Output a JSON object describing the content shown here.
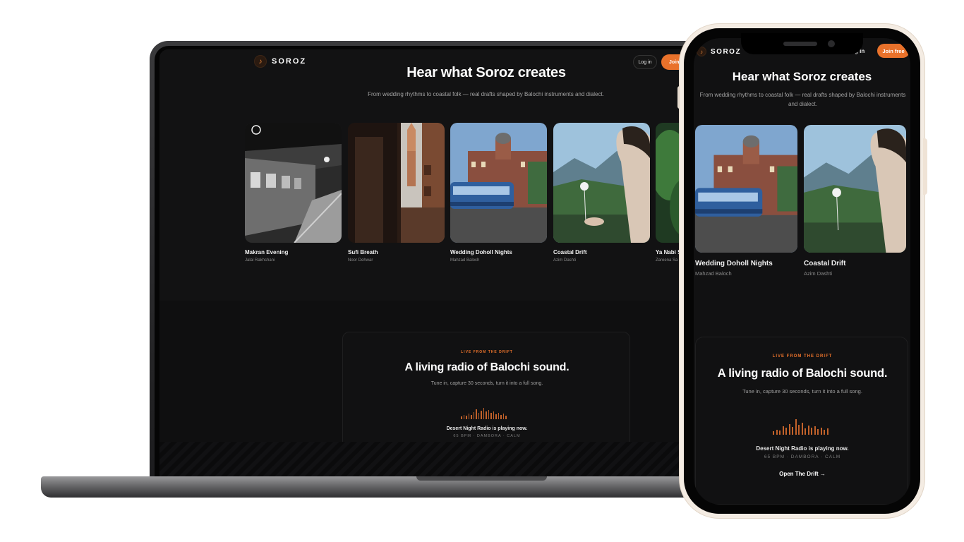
{
  "brand": {
    "name": "SOROZ",
    "accent": "#e9722b"
  },
  "nav": {
    "login": "Log in",
    "join": "Join free",
    "join_truncated": "Join",
    "login_cut": "g in"
  },
  "hero": {
    "title": "Hear what Soroz creates",
    "subtitle": "From wedding rhythms to coastal folk — real drafts shaped by Balochi instruments and dialect."
  },
  "tracks": [
    {
      "title": "Makran Evening",
      "artist": "Jalal Rakhshani",
      "scene": "subway-train"
    },
    {
      "title": "Sufi Breath",
      "artist": "Noor Dehwar",
      "scene": "narrow-street-tower"
    },
    {
      "title": "Wedding Doholl Nights",
      "artist": "Mahzad Baloch",
      "scene": "tram-building"
    },
    {
      "title": "Coastal Drift",
      "artist": "Azim Dashti",
      "scene": "woman-dandelion-mountains"
    },
    {
      "title": "Ya Nabi S",
      "artist": "Zareena Sa",
      "scene": "green-foliage"
    }
  ],
  "radio": {
    "kicker": "LIVE FROM THE DRIFT",
    "heading": "A living radio of Balochi sound.",
    "subheading": "Tune in, capture 30 seconds, turn it into a full song.",
    "now_playing": "Desert Night Radio is playing now.",
    "meta": "65 BPM · DAMBORA · CALM",
    "cta": "Open The Drift →"
  }
}
